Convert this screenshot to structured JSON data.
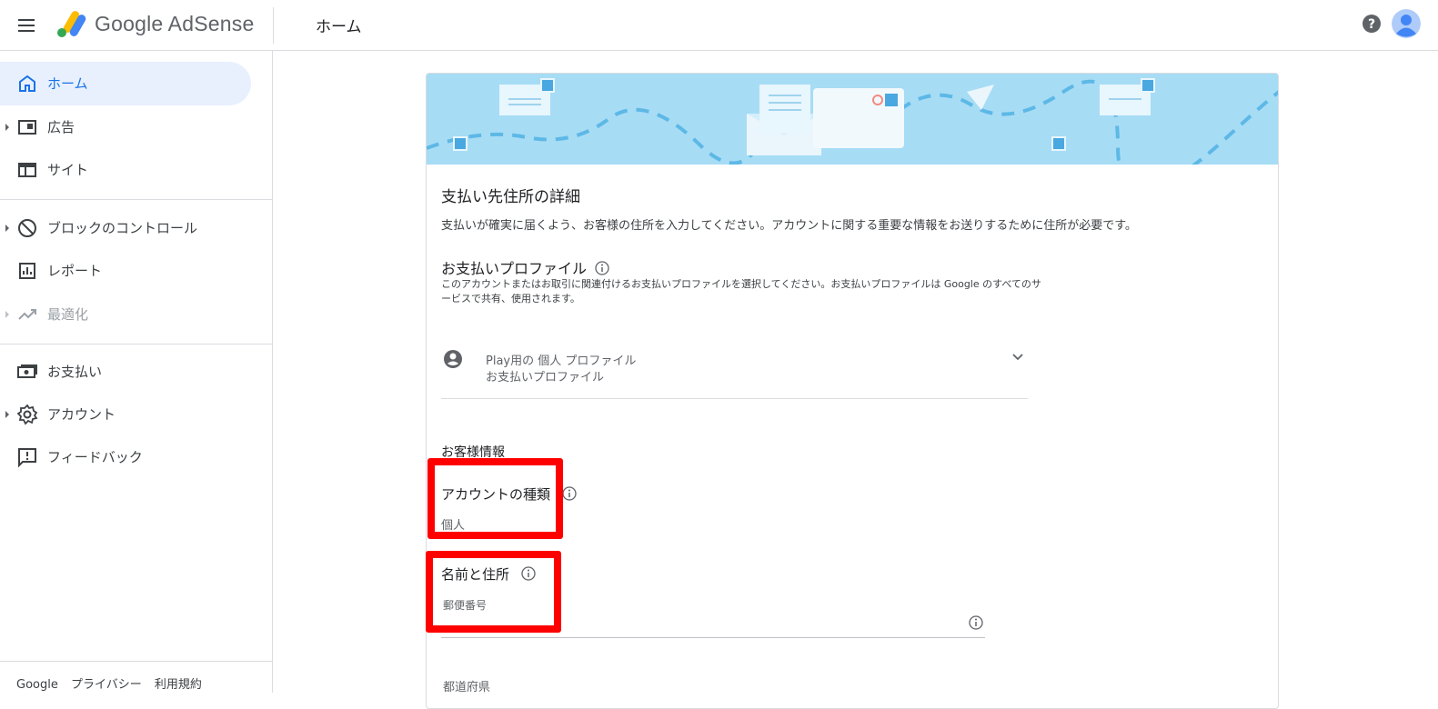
{
  "app": {
    "brand": "Google AdSense",
    "page_title": "ホーム"
  },
  "sidebar": {
    "items": [
      {
        "label": "ホーム",
        "icon": "home-icon"
      },
      {
        "label": "広告",
        "icon": "ads-icon"
      },
      {
        "label": "サイト",
        "icon": "sites-icon"
      },
      {
        "label": "ブロックのコントロール",
        "icon": "block-icon"
      },
      {
        "label": "レポート",
        "icon": "reports-icon"
      },
      {
        "label": "最適化",
        "icon": "optimization-icon"
      },
      {
        "label": "お支払い",
        "icon": "payments-icon"
      },
      {
        "label": "アカウント",
        "icon": "account-gear-icon"
      },
      {
        "label": "フィードバック",
        "icon": "feedback-icon"
      }
    ],
    "footer": [
      "Google",
      "プライバシー",
      "利用規約"
    ]
  },
  "card": {
    "title": "支払い先住所の詳細",
    "description": "支払いが確実に届くよう、お客様の住所を入力してください。アカウントに関する重要な情報をお送りするために住所が必要です。",
    "profile": {
      "title": "お支払いプロファイル",
      "description": "このアカウントまたはお取引に関連付けるお支払いプロファイルを選択してください。お支払いプロファイルは Google のすべてのサービスで共有、使用されます。",
      "selected_line1": "Play用の 個人 プロファイル",
      "selected_line2": "お支払いプロファイル"
    },
    "customer_info_title": "お客様情報",
    "account_type_label": "アカウントの種類",
    "account_type_value": "個人",
    "name_address_label": "名前と住所",
    "postal_label": "郵便番号",
    "prefecture_label": "都道府県"
  },
  "colors": {
    "accent": "#1a73e8",
    "active_bg": "#e8f0fe",
    "banner": "#a7dcf5",
    "highlight": "#ff0000"
  }
}
